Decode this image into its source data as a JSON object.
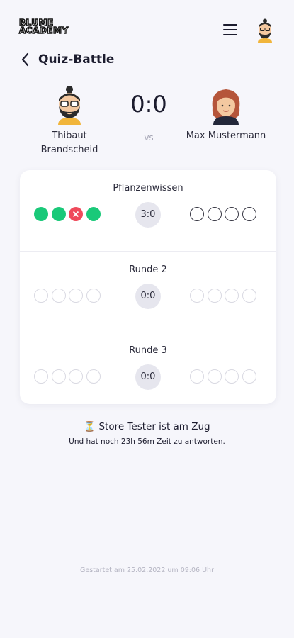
{
  "header": {
    "logo_line1": "BLUME",
    "logo_line2": "ACADEMY",
    "menu_icon": "hamburger-menu-icon"
  },
  "page": {
    "title": "Quiz-Battle",
    "back_icon": "chevron-left-icon"
  },
  "match": {
    "player_left": {
      "name": "Thibaut Brandscheid"
    },
    "player_right": {
      "name": "Max Mustermann"
    },
    "score": "0:0",
    "vs": "vs"
  },
  "rounds": [
    {
      "label": "Pflanzenwissen",
      "score": "3:0",
      "left": [
        "correct",
        "correct",
        "wrong",
        "correct"
      ],
      "right": [
        "empty",
        "empty",
        "empty",
        "empty"
      ]
    },
    {
      "label": "Runde 2",
      "score": "0:0",
      "left": [
        "inactive",
        "inactive",
        "inactive",
        "inactive"
      ],
      "right": [
        "inactive",
        "inactive",
        "inactive",
        "inactive"
      ]
    },
    {
      "label": "Runde 3",
      "score": "0:0",
      "left": [
        "inactive",
        "inactive",
        "inactive",
        "inactive"
      ],
      "right": [
        "inactive",
        "inactive",
        "inactive",
        "inactive"
      ]
    }
  ],
  "status": {
    "line": "⏳ Store Tester ist am Zug",
    "sub": "Und hat noch 23h 56m Zeit zu antworten."
  },
  "footer": {
    "started": "Gestartet am 25.02.2022 um 09:06 Uhr"
  },
  "colors": {
    "correct": "#1ac979",
    "wrong": "#ef4a5b",
    "background": "#f6f6fb"
  }
}
